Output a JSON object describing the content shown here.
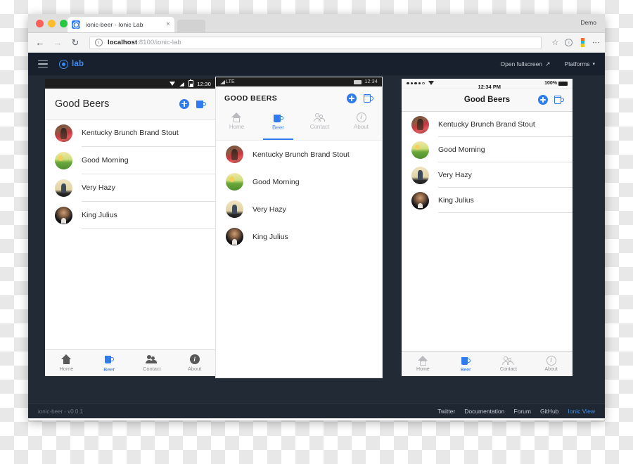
{
  "browser": {
    "tab_title": "ionic-beer - Ionic Lab",
    "tab_close": "×",
    "demo_label": "Demo",
    "back_icon": "←",
    "forward_icon": "→",
    "reload_icon": "↻",
    "omnibox": {
      "info_icon": "i",
      "host": "localhost",
      "path": ":8100/ionic-lab"
    },
    "star_icon": "☆",
    "menu_icon": "⋮"
  },
  "lab_header": {
    "menu_icon": "hamburger-icon",
    "logo_text": "lab",
    "fullscreen_label": "Open fullscreen",
    "fullscreen_icon": "↗",
    "platforms_label": "Platforms",
    "platforms_caret": "▾"
  },
  "status_bar": {
    "version": "ionic-beer - v0.0.1",
    "links": [
      {
        "label": "Twitter",
        "accent": false
      },
      {
        "label": "Documentation",
        "accent": false
      },
      {
        "label": "Forum",
        "accent": false
      },
      {
        "label": "GitHub",
        "accent": false
      },
      {
        "label": "Ionic View",
        "accent": true
      }
    ]
  },
  "beers": [
    {
      "name": "Kentucky Brunch Brand Stout",
      "avatar": "av1"
    },
    {
      "name": "Good Morning",
      "avatar": "av2"
    },
    {
      "name": "Very Hazy",
      "avatar": "av3"
    },
    {
      "name": "King Julius",
      "avatar": "av4"
    }
  ],
  "tabs": [
    {
      "label": "Home",
      "icon": "home-icon",
      "active": false
    },
    {
      "label": "Beer",
      "icon": "beer-mug-icon",
      "active": true
    },
    {
      "label": "Contact",
      "icon": "contacts-icon",
      "active": false
    },
    {
      "label": "About",
      "icon": "info-icon",
      "active": false
    }
  ],
  "android_phone": {
    "platform": "Android",
    "status_time": "12:30",
    "title": "Good Beers",
    "add_icon": "add-icon",
    "beer_icon": "beer-mug-icon"
  },
  "windows_phone": {
    "platform": "Windows",
    "carrier": "LTE",
    "status_time": "12:34",
    "title": "GOOD BEERS",
    "add_icon": "add-icon",
    "beer_icon": "beer-mug-icon"
  },
  "ios_phone": {
    "platform": "iOS",
    "status_time": "12:34 PM",
    "battery_pct": "100%",
    "title": "Good Beers",
    "add_icon": "add-icon",
    "beer_icon": "beer-mug-icon"
  },
  "colors": {
    "accent_blue": "#2f7bf0",
    "lab_dark": "#17202c",
    "stage_dark": "#222a35",
    "status_dark": "#1f2732",
    "muted_gray": "#8e8e93"
  }
}
